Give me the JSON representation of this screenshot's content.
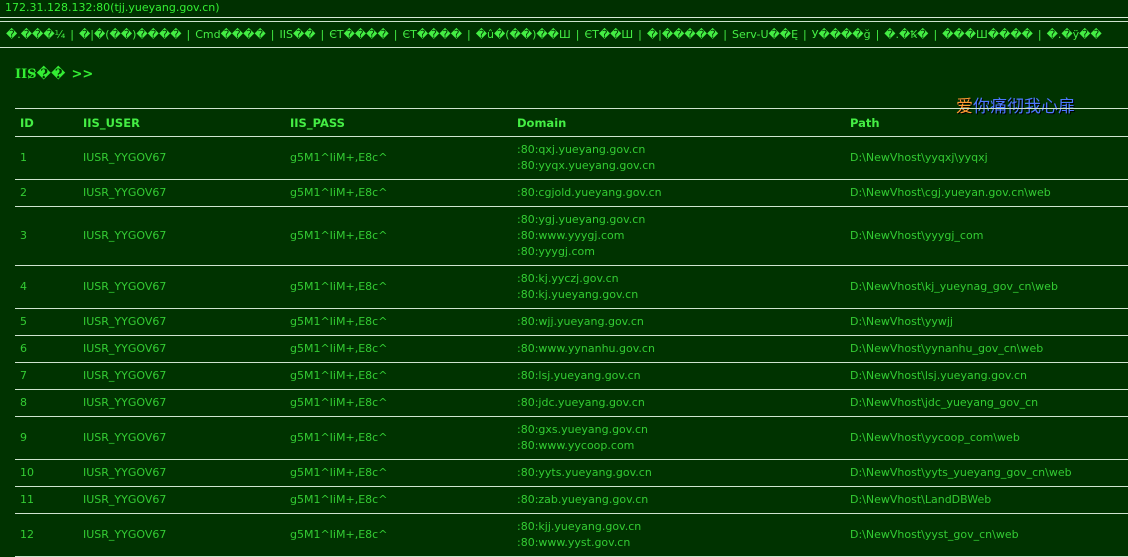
{
  "address_bar": "172.31.128.132:80(tjj.yueyang.gov.cn)",
  "menu": [
    "�.���¼",
    "�|�(��)����",
    "Cmd����",
    "IIS��",
    "ЄT����",
    "ЄT����",
    "�û�(��)��Ш",
    "ЄT��Ш",
    "�|�����",
    "Serv-U��Ę",
    "У����ğ",
    "�.�Ꝅ�",
    "���Ш����",
    "�.�ÿ��"
  ],
  "heading": {
    "title": "IIS̷��",
    "arrows": ">>"
  },
  "decor_text": {
    "first": "爱",
    "rest": "你痛彻我心扉"
  },
  "table": {
    "headers": [
      "ID",
      "IIS_USER",
      "IIS_PASS",
      "Domain",
      "Path"
    ],
    "rows": [
      {
        "id": "1",
        "user": "IUSR_YYGOV67",
        "pass": "g5M1^IiM+,E8c^",
        "domains": [
          ":80:qxj.yueyang.gov.cn",
          ":80:yyqx.yueyang.gov.cn"
        ],
        "path": "D:\\NewVhost\\yyqxj\\yyqxj"
      },
      {
        "id": "2",
        "user": "IUSR_YYGOV67",
        "pass": "g5M1^IiM+,E8c^",
        "domains": [
          ":80:cgjold.yueyang.gov.cn"
        ],
        "path": "D:\\NewVhost\\cgj.yueyan.gov.cn\\web"
      },
      {
        "id": "3",
        "user": "IUSR_YYGOV67",
        "pass": "g5M1^IiM+,E8c^",
        "domains": [
          ":80:ygj.yueyang.gov.cn",
          ":80:www.yyygj.com",
          ":80:yyygj.com"
        ],
        "path": "D:\\NewVhost\\yyygj_com"
      },
      {
        "id": "4",
        "user": "IUSR_YYGOV67",
        "pass": "g5M1^IiM+,E8c^",
        "domains": [
          ":80:kj.yyczj.gov.cn",
          ":80:kj.yueyang.gov.cn"
        ],
        "path": "D:\\NewVhost\\kj_yueynag_gov_cn\\web"
      },
      {
        "id": "5",
        "user": "IUSR_YYGOV67",
        "pass": "g5M1^IiM+,E8c^",
        "domains": [
          ":80:wjj.yueyang.gov.cn"
        ],
        "path": "D:\\NewVhost\\yywjj"
      },
      {
        "id": "6",
        "user": "IUSR_YYGOV67",
        "pass": "g5M1^IiM+,E8c^",
        "domains": [
          ":80:www.yynanhu.gov.cn"
        ],
        "path": "D:\\NewVhost\\yynanhu_gov_cn\\web"
      },
      {
        "id": "7",
        "user": "IUSR_YYGOV67",
        "pass": "g5M1^IiM+,E8c^",
        "domains": [
          ":80:lsj.yueyang.gov.cn"
        ],
        "path": "D:\\NewVhost\\lsj.yueyang.gov.cn"
      },
      {
        "id": "8",
        "user": "IUSR_YYGOV67",
        "pass": "g5M1^IiM+,E8c^",
        "domains": [
          ":80:jdc.yueyang.gov.cn"
        ],
        "path": "D:\\NewVhost\\jdc_yueyang_gov_cn"
      },
      {
        "id": "9",
        "user": "IUSR_YYGOV67",
        "pass": "g5M1^IiM+,E8c^",
        "domains": [
          ":80:gxs.yueyang.gov.cn",
          ":80:www.yycoop.com"
        ],
        "path": "D:\\NewVhost\\yycoop_com\\web"
      },
      {
        "id": "10",
        "user": "IUSR_YYGOV67",
        "pass": "g5M1^IiM+,E8c^",
        "domains": [
          ":80:yyts.yueyang.gov.cn"
        ],
        "path": "D:\\NewVhost\\yyts_yueyang_gov_cn\\web"
      },
      {
        "id": "11",
        "user": "IUSR_YYGOV67",
        "pass": "g5M1^IiM+,E8c^",
        "domains": [
          ":80:zab.yueyang.gov.cn"
        ],
        "path": "D:\\NewVhost\\LandDBWeb"
      },
      {
        "id": "12",
        "user": "IUSR_YYGOV67",
        "pass": "g5M1^IiM+,E8c^",
        "domains": [
          ":80:kjj.yueyang.gov.cn",
          ":80:www.yyst.gov.cn"
        ],
        "path": "D:\\NewVhost\\yyst_gov_cn\\web"
      }
    ]
  }
}
